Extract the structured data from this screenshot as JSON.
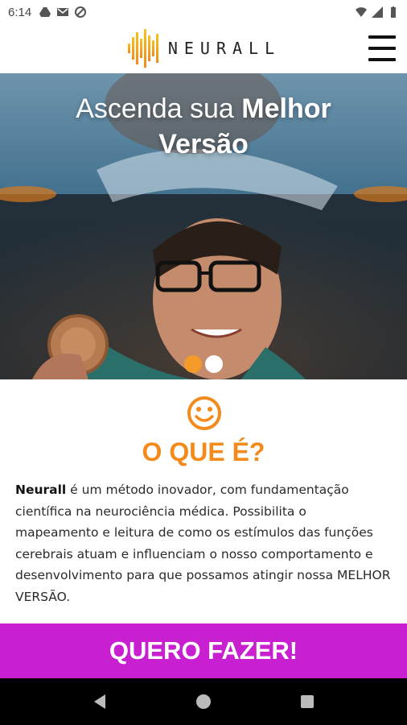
{
  "status_bar": {
    "time": "6:14"
  },
  "header": {
    "brand": "NEURALL"
  },
  "hero": {
    "title_light": "Ascenda sua ",
    "title_bold_1": "Melhor",
    "title_bold_2": "Versão",
    "slides": 2,
    "active_slide": 1
  },
  "section": {
    "title": "O QUE É?",
    "brand_word": "Neurall",
    "description": " é um método inovador, com fundamentação científica na neurociência médica. Possibilita o mapeamento e leitura de como os estímulos das funções cerebrais atuam e influenciam o nosso comportamento e desenvolvimento para que possamos atingir nossa MELHOR VERSÃO."
  },
  "cta": {
    "label": "QUERO FAZER!"
  },
  "colors": {
    "accent_orange": "#f28a1c",
    "cta_purple": "#c81fd1"
  }
}
